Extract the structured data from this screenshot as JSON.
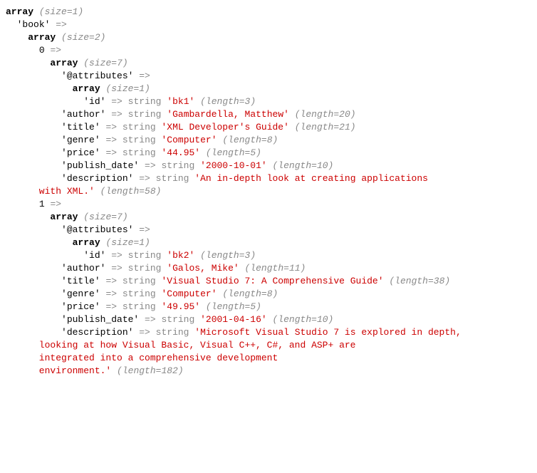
{
  "dump": {
    "type": "array",
    "size": 1,
    "items": [
      {
        "key": "'book'",
        "value": {
          "type": "array",
          "size": 2,
          "items": [
            {
              "key": "0",
              "value": {
                "type": "array",
                "size": 7,
                "items": [
                  {
                    "key": "'@attributes'",
                    "value": {
                      "type": "array",
                      "size": 1,
                      "items": [
                        {
                          "key": "'id'",
                          "value": {
                            "type": "string",
                            "val": "'bk1'",
                            "len": 3
                          }
                        }
                      ]
                    }
                  },
                  {
                    "key": "'author'",
                    "value": {
                      "type": "string",
                      "val": "'Gambardella, Matthew'",
                      "len": 20
                    }
                  },
                  {
                    "key": "'title'",
                    "value": {
                      "type": "string",
                      "val": "'XML Developer's Guide'",
                      "len": 21
                    }
                  },
                  {
                    "key": "'genre'",
                    "value": {
                      "type": "string",
                      "val": "'Computer'",
                      "len": 8
                    }
                  },
                  {
                    "key": "'price'",
                    "value": {
                      "type": "string",
                      "val": "'44.95'",
                      "len": 5
                    }
                  },
                  {
                    "key": "'publish_date'",
                    "value": {
                      "type": "string",
                      "val": "'2000-10-01'",
                      "len": 10
                    }
                  },
                  {
                    "key": "'description'",
                    "value": {
                      "type": "string",
                      "val": "'An in-depth look at creating applications \n      with XML.'",
                      "len": 58
                    }
                  }
                ]
              }
            },
            {
              "key": "1",
              "value": {
                "type": "array",
                "size": 7,
                "items": [
                  {
                    "key": "'@attributes'",
                    "value": {
                      "type": "array",
                      "size": 1,
                      "items": [
                        {
                          "key": "'id'",
                          "value": {
                            "type": "string",
                            "val": "'bk2'",
                            "len": 3
                          }
                        }
                      ]
                    }
                  },
                  {
                    "key": "'author'",
                    "value": {
                      "type": "string",
                      "val": "'Galos, Mike'",
                      "len": 11
                    }
                  },
                  {
                    "key": "'title'",
                    "value": {
                      "type": "string",
                      "val": "'Visual Studio 7: A Comprehensive Guide'",
                      "len": 38
                    }
                  },
                  {
                    "key": "'genre'",
                    "value": {
                      "type": "string",
                      "val": "'Computer'",
                      "len": 8
                    }
                  },
                  {
                    "key": "'price'",
                    "value": {
                      "type": "string",
                      "val": "'49.95'",
                      "len": 5
                    }
                  },
                  {
                    "key": "'publish_date'",
                    "value": {
                      "type": "string",
                      "val": "'2001-04-16'",
                      "len": 10
                    }
                  },
                  {
                    "key": "'description'",
                    "value": {
                      "type": "string",
                      "val": "'Microsoft Visual Studio 7 is explored in depth,\n      looking at how Visual Basic, Visual C++, C#, and ASP+ are \n      integrated into a comprehensive development \n      environment.'",
                      "len": 182
                    }
                  }
                ]
              }
            }
          ]
        }
      }
    ]
  }
}
